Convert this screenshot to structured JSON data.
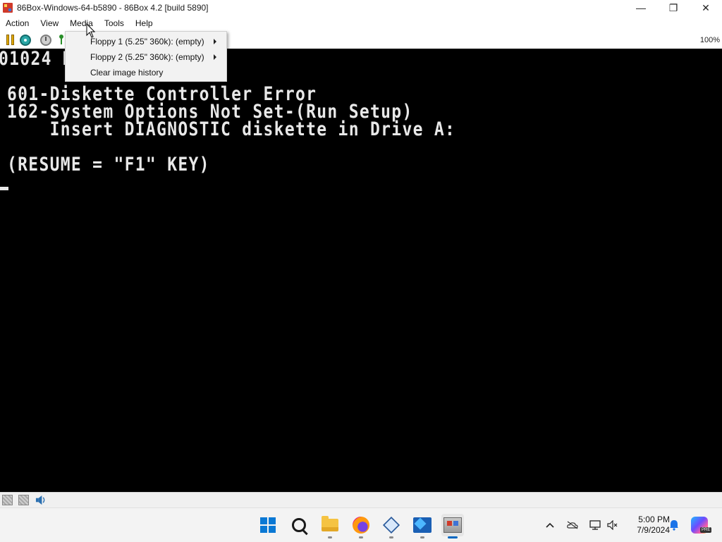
{
  "window": {
    "title": "86Box-Windows-64-b5890 - 86Box 4.2 [build 5890]",
    "minimize_glyph": "—",
    "maximize_glyph": "❐",
    "close_glyph": "✕"
  },
  "menubar": {
    "items": [
      "Action",
      "View",
      "Media",
      "Tools",
      "Help"
    ]
  },
  "media_menu": {
    "items": [
      {
        "label": "Floppy 1 (5.25\" 360k): (empty)",
        "has_submenu": true
      },
      {
        "label": "Floppy 2 (5.25\" 360k): (empty)",
        "has_submenu": true
      },
      {
        "label": "Clear image history",
        "has_submenu": false
      }
    ]
  },
  "toolbar": {
    "icons": [
      "pause-icon",
      "hard-reset-icon",
      "power-icon",
      "ctrl-alt-del-icon"
    ],
    "zoom": "100%"
  },
  "screen": {
    "lines": [
      "01024 KB",
      "601-Diskette Controller Error",
      "162-System Options Not Set-(Run Setup)",
      "    Insert DIAGNOSTIC diskette in Drive A:",
      "(RESUME = \"F1\" KEY)"
    ],
    "text_color": "#e8e8e8",
    "background": "#000000"
  },
  "statusbar": {
    "icons": [
      "floppy-1-icon",
      "floppy-2-icon",
      "sound-icon"
    ]
  },
  "taskbar": {
    "apps": [
      "start-icon",
      "search-icon",
      "file-explorer-icon",
      "firefox-icon",
      "virtualbox-icon",
      "vm-icon",
      "86box-icon"
    ],
    "tray": [
      "chevron-up-icon",
      "onedrive-icon",
      "network-icon",
      "volume-icon",
      "notification-bell-icon",
      "copilot-icon"
    ],
    "time": "5:00 PM",
    "date": "7/9/2024",
    "copilot_badge": "PRE"
  }
}
